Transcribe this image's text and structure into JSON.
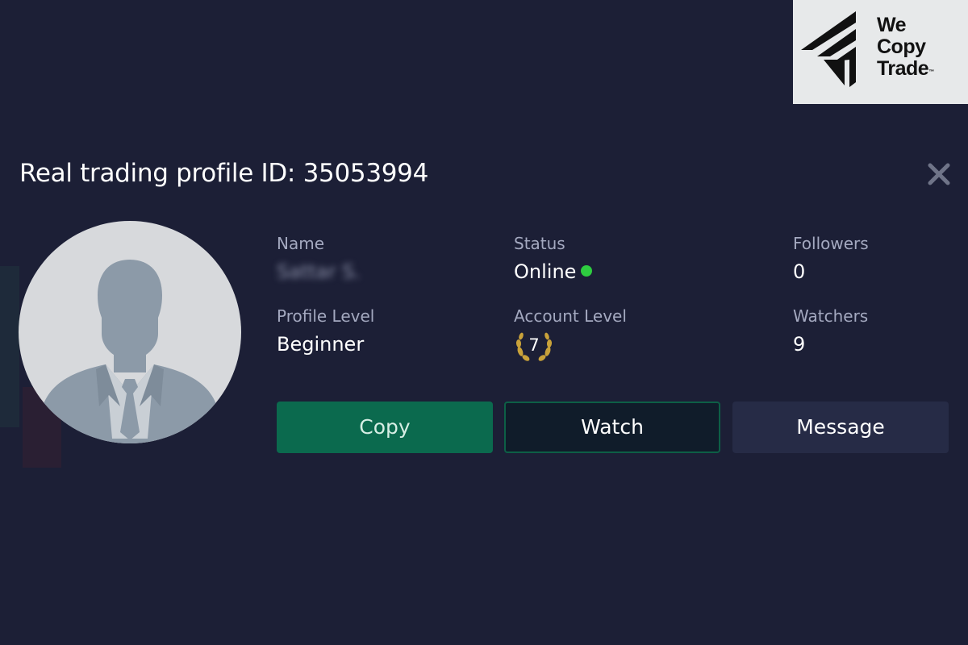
{
  "logo": {
    "line1": "We",
    "line2": "Copy",
    "line3": "Trade",
    "trademark": "™"
  },
  "title": "Real trading profile ID: 35053994",
  "close_icon": "close-icon",
  "profile": {
    "name_label": "Name",
    "name_value": "Sattar S.",
    "status_label": "Status",
    "status_value": "Online",
    "followers_label": "Followers",
    "followers_value": "0",
    "profile_level_label": "Profile Level",
    "profile_level_value": "Beginner",
    "account_level_label": "Account Level",
    "account_level_value": "7",
    "watchers_label": "Watchers",
    "watchers_value": "9"
  },
  "actions": {
    "copy_label": "Copy",
    "watch_label": "Watch",
    "message_label": "Message"
  },
  "colors": {
    "background": "#1c1f36",
    "copy_button": "#0b6a4e",
    "watch_border": "#0d5f46",
    "message_button": "#262b46",
    "online": "#2ecc40",
    "laurel": "#c9a23a"
  }
}
